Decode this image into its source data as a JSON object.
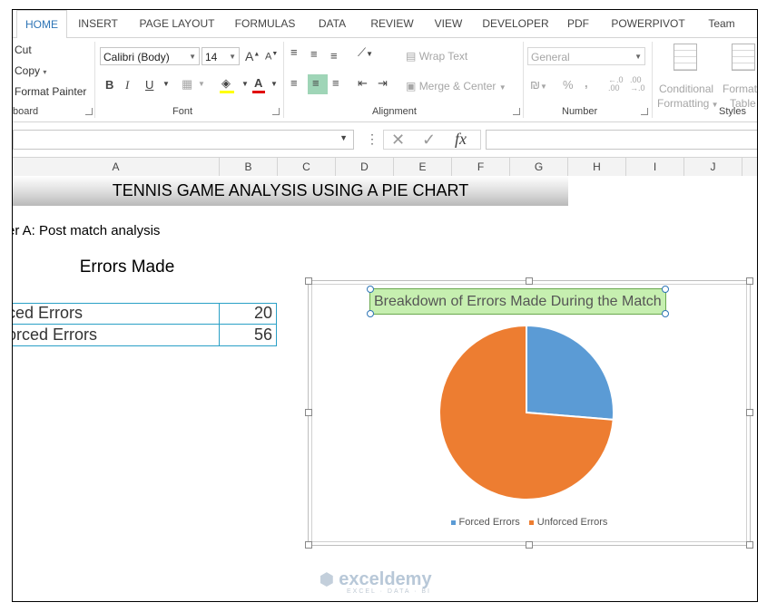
{
  "ribbon_tabs": [
    "HOME",
    "INSERT",
    "PAGE LAYOUT",
    "FORMULAS",
    "DATA",
    "REVIEW",
    "VIEW",
    "DEVELOPER",
    "PDF",
    "POWERPIVOT",
    "Team"
  ],
  "clipboard": {
    "cut": "Cut",
    "copy": "Copy",
    "format_painter": "Format Painter",
    "label": "board"
  },
  "font": {
    "name": "Calibri (Body)",
    "size": "14",
    "label": "Font",
    "bold": "B",
    "italic": "I",
    "underline": "U",
    "grow": "A",
    "shrink": "A",
    "color_letter": "A"
  },
  "alignment": {
    "wrap_text": "Wrap Text",
    "merge_center": "Merge & Center",
    "label": "Alignment"
  },
  "number": {
    "format": "General",
    "label": "Number",
    "percent": "%",
    "comma": ","
  },
  "styles": {
    "conditional": "Conditional",
    "formatting": "Formatting",
    "format_as": "Format",
    "table": "Table",
    "label": "Styles"
  },
  "formula_bar": {
    "fx": "fx",
    "name_value": "",
    "formula_value": ""
  },
  "columns": [
    "A",
    "B",
    "C",
    "D",
    "E",
    "F",
    "G",
    "H",
    "I",
    "J"
  ],
  "sheet": {
    "banner": "TENNIS GAME ANALYSIS USING A PIE CHART",
    "subtitle": "er A: Post match analysis",
    "table_title": "Errors Made",
    "rows": [
      {
        "label": "ced Errors",
        "value": "20"
      },
      {
        "label": "orced Errors",
        "value": "56"
      }
    ]
  },
  "chart_data": {
    "type": "pie",
    "title": "Breakdown of Errors Made During the Match",
    "categories": [
      "Forced Errors",
      "Unforced Errors"
    ],
    "values": [
      20,
      56
    ],
    "colors": [
      "#5b9bd5",
      "#ed7d31"
    ],
    "legend": "bottom"
  },
  "watermark": {
    "brand": "exceldemy",
    "tag": "EXCEL · DATA · BI"
  }
}
